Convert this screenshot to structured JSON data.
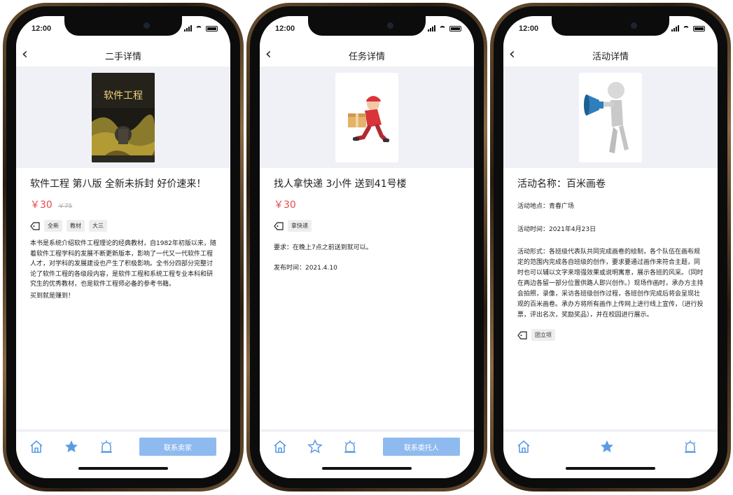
{
  "phones": [
    {
      "status_time": "12:00",
      "nav_title": "二手详情",
      "headline": "软件工程 第八版 全新未拆封 好价速来！",
      "price": "￥30",
      "old_price": "￥75",
      "tags": [
        "全新",
        "教材",
        "大三"
      ],
      "description": [
        "本书是系统介绍软件工程理论的经典教材，自1982年初版以来，随着软件工程学科的发展不断更新版本，影响了一代又一代软件工程人才，对学科的发展建设也产生了积极影响。全书分四部分完整讨论了软件工程的各级段内容，是软件工程和系统工程专业本科和研究生的优秀教材，也是软件工程师必备的参考书籍。",
        "买到就是赚到！"
      ],
      "book_cover_title": "软件工程",
      "cta_label": "联系卖家"
    },
    {
      "status_time": "12:00",
      "nav_title": "任务详情",
      "headline": "找人拿快递 3小件 送到41号楼",
      "price": "￥30",
      "tags": [
        "拿快递"
      ],
      "requirement": "要求：在晚上7点之前送到就可以。",
      "publish_time": "发布时间：2021.4.10",
      "cta_label": "联系委托人"
    },
    {
      "status_time": "12:00",
      "nav_title": "活动详情",
      "headline": "活动名称：百米画卷",
      "location": "活动地点：青春广场",
      "time": "活动时间：2021年4月23日",
      "form": "活动形式：各班级代表队共同完成画卷的绘制，各个队伍在画布规定的范围内完成各自班级的创作，要求要通过画作来符合主题，同时也可以辅以文字来增强效果或说明寓意，展示各班的风采。（同时在两边各留一部分位置供路人即兴创作。）现场作画时，承办方主持会拍照，录像，采访各班级创作过程，各班创作完成后将会呈现壮观的百米画卷。承办方将所有画作上传网上进行线上宣传，（进行投票，评出名次，奖励奖品），并在校园进行展示。",
      "tags": [
        "团立项"
      ]
    }
  ],
  "colors": {
    "accent": "#8fbaf0",
    "icon_blue": "#5b9be3",
    "price_red": "#e84a4a",
    "page_bg": "#f0f1f6"
  },
  "icons": [
    "back-chevron-icon",
    "home-icon",
    "star-icon",
    "alarm-icon",
    "tag-icon",
    "signal-icon",
    "wifi-icon",
    "battery-icon"
  ]
}
